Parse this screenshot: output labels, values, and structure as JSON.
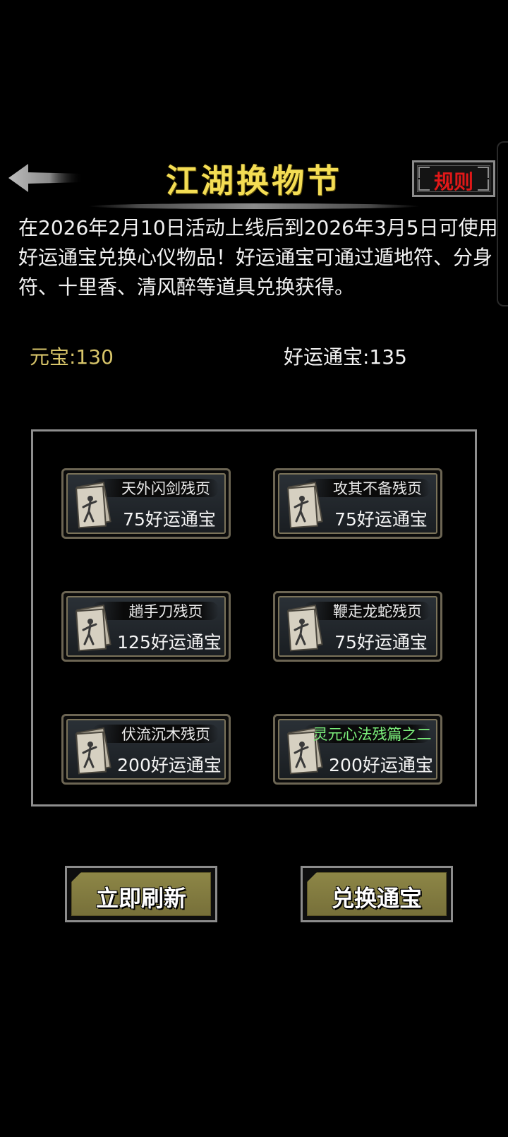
{
  "header": {
    "title": "江湖换物节",
    "rules_label": "规则",
    "back_icon": "back-arrow-icon"
  },
  "description": "在2026年2月10日活动上线后到2026年3月5日可使用好运通宝兑换心仪物品！好运通宝可通过遁地符、分身符、十里香、清风醉等道具兑换获得。",
  "currencies": {
    "yuanbao": "元宝:130",
    "haoyun": "好运通宝:135"
  },
  "items": [
    {
      "name": "天外闪剑残页",
      "price": "75好运通宝",
      "icon": "scroll-page-icon",
      "highlight": false
    },
    {
      "name": "攻其不备残页",
      "price": "75好运通宝",
      "icon": "scroll-page-icon",
      "highlight": false
    },
    {
      "name": "趟手刀残页",
      "price": "125好运通宝",
      "icon": "scroll-page-icon",
      "highlight": false
    },
    {
      "name": "鞭走龙蛇残页",
      "price": "75好运通宝",
      "icon": "scroll-page-icon",
      "highlight": false
    },
    {
      "name": "伏流沉木残页",
      "price": "200好运通宝",
      "icon": "scroll-page-icon",
      "highlight": false
    },
    {
      "name": "灵元心法残篇之二",
      "price": "200好运通宝",
      "icon": "scroll-page-icon",
      "highlight": true
    }
  ],
  "buttons": {
    "refresh": "立即刷新",
    "exchange": "兑换通宝"
  },
  "colors": {
    "title": "#f4dd54",
    "rules_text": "#e01818",
    "yuanbao": "#d8c56a",
    "highlight_item": "#7cf07c",
    "button_face": "#8d8646"
  }
}
